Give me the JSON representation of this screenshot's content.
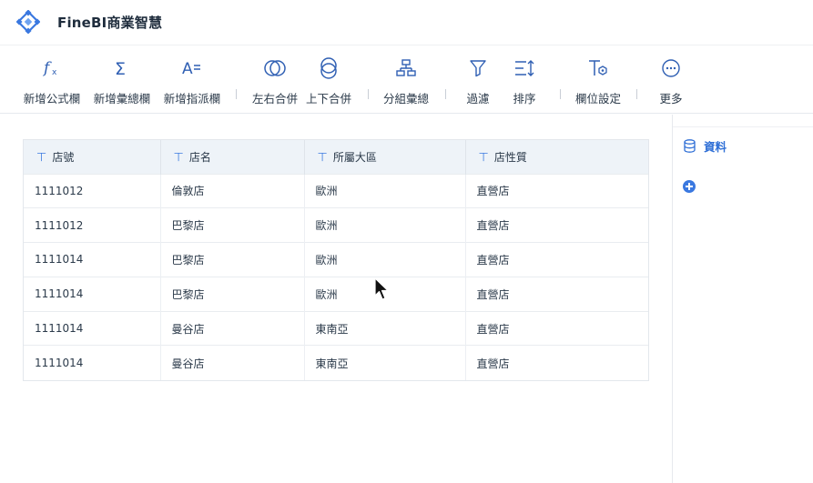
{
  "app": {
    "title": "FineBI商業智慧"
  },
  "toolbar": {
    "items": [
      {
        "label": "新增公式欄",
        "icon": "formula-icon"
      },
      {
        "label": "新增彙總欄",
        "icon": "sigma-icon"
      },
      {
        "label": "新增指派欄",
        "icon": "assign-icon"
      },
      {
        "label": "左右合併",
        "icon": "merge-horizontal-icon"
      },
      {
        "label": "上下合併",
        "icon": "merge-vertical-icon"
      },
      {
        "label": "分組彙總",
        "icon": "group-summary-icon"
      },
      {
        "label": "過濾",
        "icon": "filter-icon"
      },
      {
        "label": "排序",
        "icon": "sort-icon"
      },
      {
        "label": "欄位設定",
        "icon": "field-settings-icon"
      },
      {
        "label": "更多",
        "icon": "more-icon"
      }
    ]
  },
  "table": {
    "columns": [
      "店號",
      "店名",
      "所屬大區",
      "店性質"
    ],
    "rows": [
      [
        "1111012",
        "倫敦店",
        "歐洲",
        "直營店"
      ],
      [
        "1111012",
        "巴黎店",
        "歐洲",
        "直營店"
      ],
      [
        "1111014",
        "巴黎店",
        "歐洲",
        "直營店"
      ],
      [
        "1111014",
        "巴黎店",
        "歐洲",
        "直營店"
      ],
      [
        "1111014",
        "曼谷店",
        "東南亞",
        "直營店"
      ],
      [
        "1111014",
        "曼谷店",
        "東南亞",
        "直營店"
      ]
    ]
  },
  "sidepanel": {
    "data_label": "資料"
  },
  "colors": {
    "accent": "#2f6fd6",
    "header_bg": "#eef3f8",
    "text": "#2b3a4a"
  }
}
